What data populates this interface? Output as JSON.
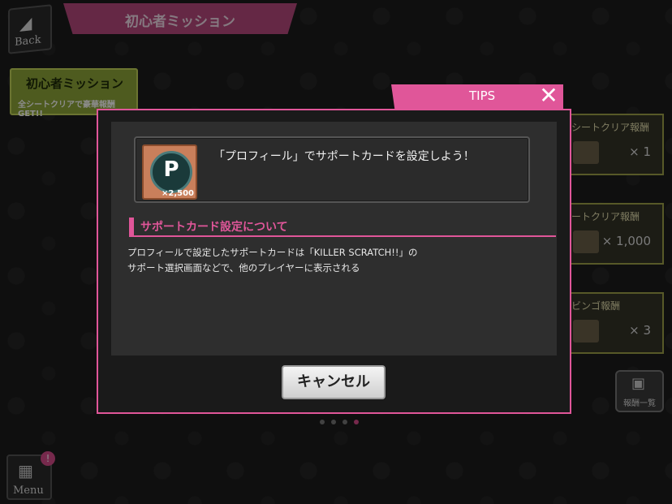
{
  "header": {
    "back_label": "Back",
    "title": "初心者ミッション"
  },
  "mission_badge": {
    "title": "初心者ミッション",
    "subtitle": "全シートクリアで豪華報酬GET!!"
  },
  "reward_cards": [
    {
      "heading": "シートクリア報酬",
      "quantity": "× 1"
    },
    {
      "heading": "ートクリア報酬",
      "quantity": "× 1,000"
    },
    {
      "heading": "ビンゴ報酬",
      "quantity": "× 3"
    }
  ],
  "reward_list_button": {
    "label": "報酬一覧"
  },
  "menu": {
    "label": "Menu",
    "badge": "!"
  },
  "pager": {
    "total": 4,
    "active_index": 3
  },
  "tips": {
    "tab_label": "TIPS",
    "card": {
      "item_letter": "P",
      "item_quantity": "×2,500",
      "text": "「プロフィール」でサポートカードを設定しよう！"
    },
    "section_title": "サポートカード設定について",
    "description_line1": "プロフィールで設定したサポートカードは「KILLER SCRATCH!!」の",
    "description_line2": "サポート選択画面などで、他のプレイヤーに表示される",
    "cancel_label": "キャンセル"
  },
  "colors": {
    "accent_pink": "#e05699",
    "mission_green": "#8ea63a"
  }
}
